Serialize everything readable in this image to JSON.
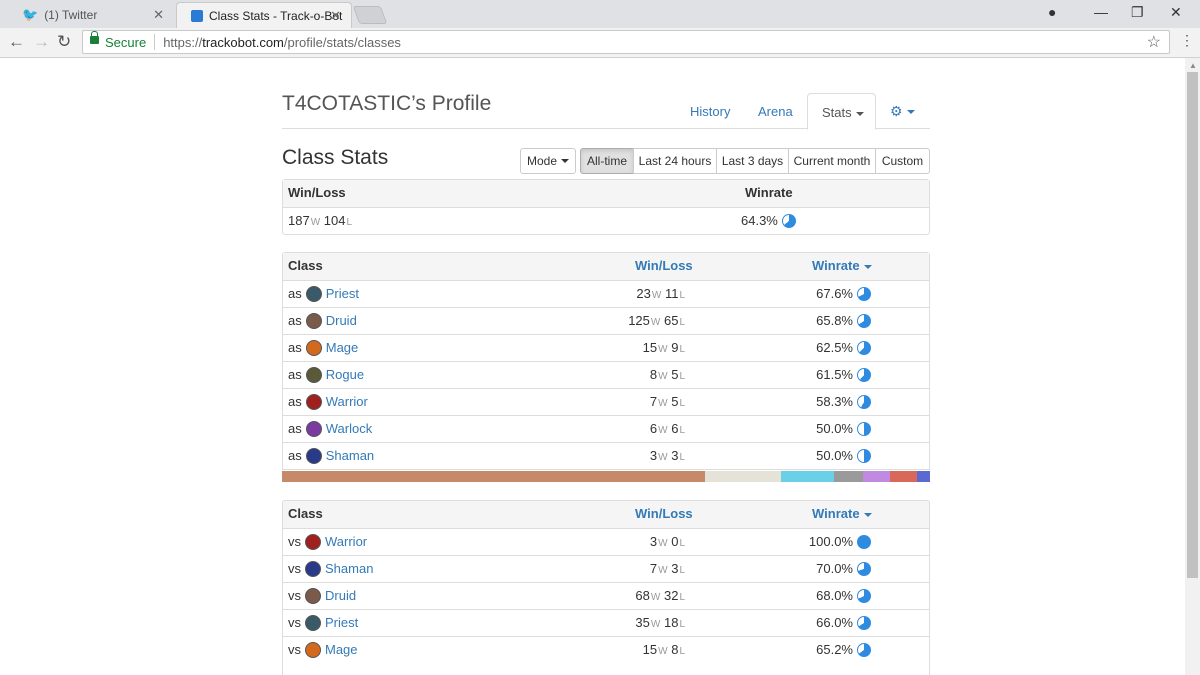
{
  "browser": {
    "tabs": [
      {
        "title": "(1) Twitter",
        "active": false
      },
      {
        "title": "Class Stats - Track-o-Bot",
        "active": true
      }
    ],
    "secure_label": "Secure",
    "url_scheme": "https://",
    "url_host": "trackobot.com",
    "url_path": "/profile/stats/classes"
  },
  "header": {
    "profile_title": "T4COTASTIC’s Profile",
    "nav": {
      "history": "History",
      "arena": "Arena",
      "stats": "Stats"
    }
  },
  "stats": {
    "heading": "Class Stats",
    "mode_label": "Mode",
    "time_filters": [
      "All-time",
      "Last 24 hours",
      "Last 3 days",
      "Current month",
      "Custom"
    ],
    "active_filter": "All-time"
  },
  "summary": {
    "headers": {
      "winloss": "Win/Loss",
      "winrate": "Winrate"
    },
    "wins": "187",
    "losses": "104",
    "winrate": "64.3%",
    "winrate_value": 0.643
  },
  "as_table": {
    "headers": {
      "class": "Class",
      "winloss": "Win/Loss",
      "winrate": "Winrate"
    },
    "rows": [
      {
        "prefix": "as",
        "cls": "Priest",
        "w": "23",
        "l": "11",
        "rate": "67.6%",
        "rate_value": 0.676,
        "icon_color": "#3a5a6a"
      },
      {
        "prefix": "as",
        "cls": "Druid",
        "w": "125",
        "l": "65",
        "rate": "65.8%",
        "rate_value": 0.658,
        "icon_color": "#7a5a4a"
      },
      {
        "prefix": "as",
        "cls": "Mage",
        "w": "15",
        "l": "9",
        "rate": "62.5%",
        "rate_value": 0.625,
        "icon_color": "#d2691e"
      },
      {
        "prefix": "as",
        "cls": "Rogue",
        "w": "8",
        "l": "5",
        "rate": "61.5%",
        "rate_value": 0.615,
        "icon_color": "#5a5a3a"
      },
      {
        "prefix": "as",
        "cls": "Warrior",
        "w": "7",
        "l": "5",
        "rate": "58.3%",
        "rate_value": 0.583,
        "icon_color": "#a02020"
      },
      {
        "prefix": "as",
        "cls": "Warlock",
        "w": "6",
        "l": "6",
        "rate": "50.0%",
        "rate_value": 0.5,
        "icon_color": "#7a3aa0"
      },
      {
        "prefix": "as",
        "cls": "Shaman",
        "w": "3",
        "l": "3",
        "rate": "50.0%",
        "rate_value": 0.5,
        "icon_color": "#2a3a8a"
      }
    ],
    "distribution_colors": [
      "#c68a6a",
      "#e5e2d8",
      "#6ad0e8",
      "#9a9a9a",
      "#c08ae0",
      "#d8685a",
      "#5a6ad0"
    ],
    "distribution_games": [
      190,
      34,
      24,
      13,
      12,
      12,
      6
    ]
  },
  "vs_table": {
    "headers": {
      "class": "Class",
      "winloss": "Win/Loss",
      "winrate": "Winrate"
    },
    "rows": [
      {
        "prefix": "vs",
        "cls": "Warrior",
        "w": "3",
        "l": "0",
        "rate": "100.0%",
        "rate_value": 1.0,
        "icon_color": "#a02020"
      },
      {
        "prefix": "vs",
        "cls": "Shaman",
        "w": "7",
        "l": "3",
        "rate": "70.0%",
        "rate_value": 0.7,
        "icon_color": "#2a3a8a"
      },
      {
        "prefix": "vs",
        "cls": "Druid",
        "w": "68",
        "l": "32",
        "rate": "68.0%",
        "rate_value": 0.68,
        "icon_color": "#7a5a4a"
      },
      {
        "prefix": "vs",
        "cls": "Priest",
        "w": "35",
        "l": "18",
        "rate": "66.0%",
        "rate_value": 0.66,
        "icon_color": "#3a5a6a"
      },
      {
        "prefix": "vs",
        "cls": "Mage",
        "w": "15",
        "l": "8",
        "rate": "65.2%",
        "rate_value": 0.652,
        "icon_color": "#d2691e"
      }
    ]
  },
  "units": {
    "w": "W",
    "l": "L"
  }
}
